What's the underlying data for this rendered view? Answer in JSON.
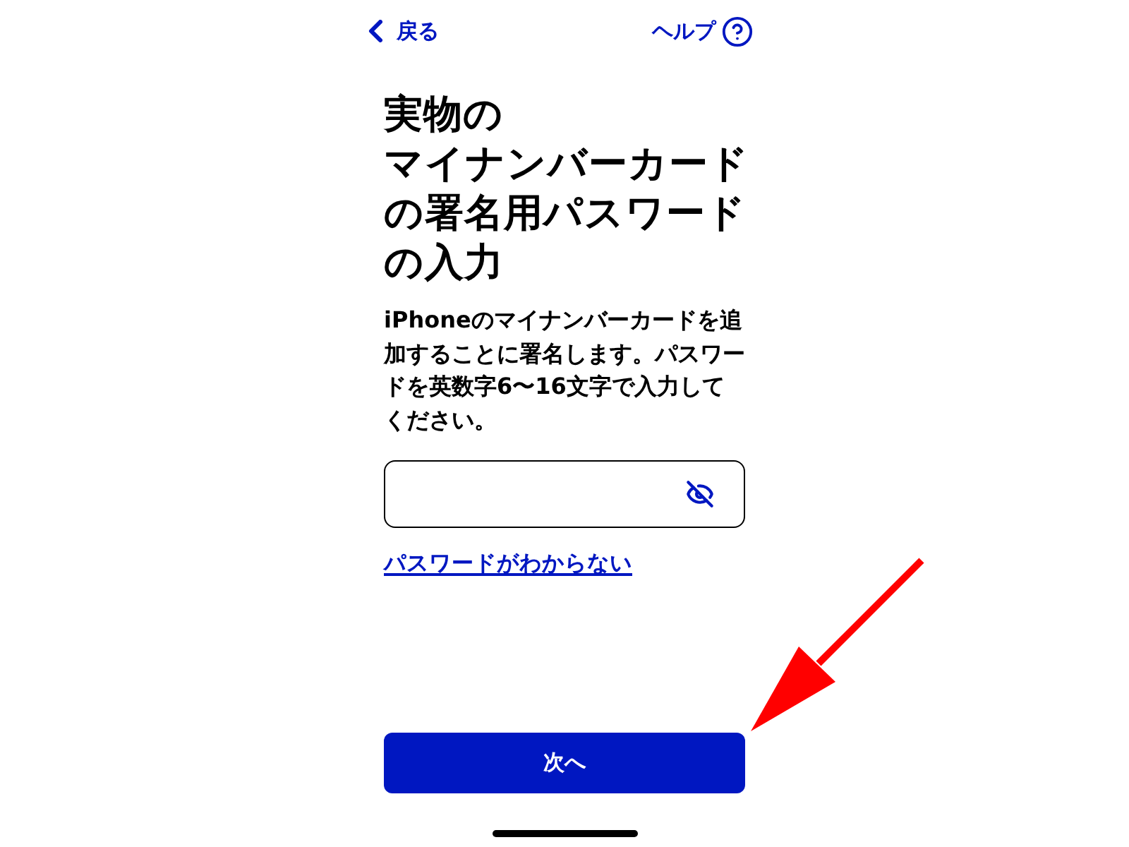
{
  "header": {
    "back": {
      "label": "戻る"
    },
    "help": {
      "label": "ヘルプ"
    }
  },
  "title_lines": [
    "実物の",
    "マイナンバーカード",
    "の署名用パスワード",
    "の入力"
  ],
  "description_lines": [
    "iPhoneのマイナンバーカードを追",
    "加することに署名します。パスワー",
    "ドを英数字6〜16文字で入力して",
    "ください。"
  ],
  "password_field": {
    "visible": false
  },
  "forgot_link": "パスワードがわからない",
  "next_button": {
    "label": "次へ"
  }
}
